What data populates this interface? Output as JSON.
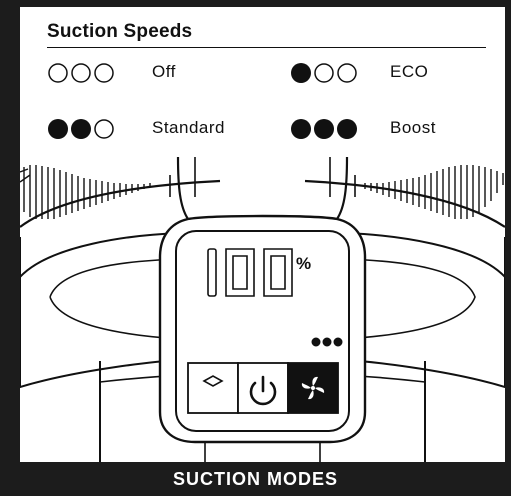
{
  "legend": {
    "title": "Suction Speeds",
    "modes": [
      {
        "label": "Off",
        "filled_dots": 0
      },
      {
        "label": "ECO",
        "filled_dots": 1
      },
      {
        "label": "Standard",
        "filled_dots": 2
      },
      {
        "label": "Boost",
        "filled_dots": 3
      }
    ]
  },
  "display": {
    "value": "100",
    "unit": "%",
    "speed_dots_filled": 3,
    "buttons": [
      {
        "icon": "diamond-icon",
        "active": false
      },
      {
        "icon": "power-icon",
        "active": false
      },
      {
        "icon": "fan-icon",
        "active": true
      }
    ]
  },
  "banner": {
    "text": "SUCTION MODES"
  },
  "colors": {
    "ink": "#111111",
    "frame": "#1c1c1c",
    "body": "#ffffff"
  }
}
